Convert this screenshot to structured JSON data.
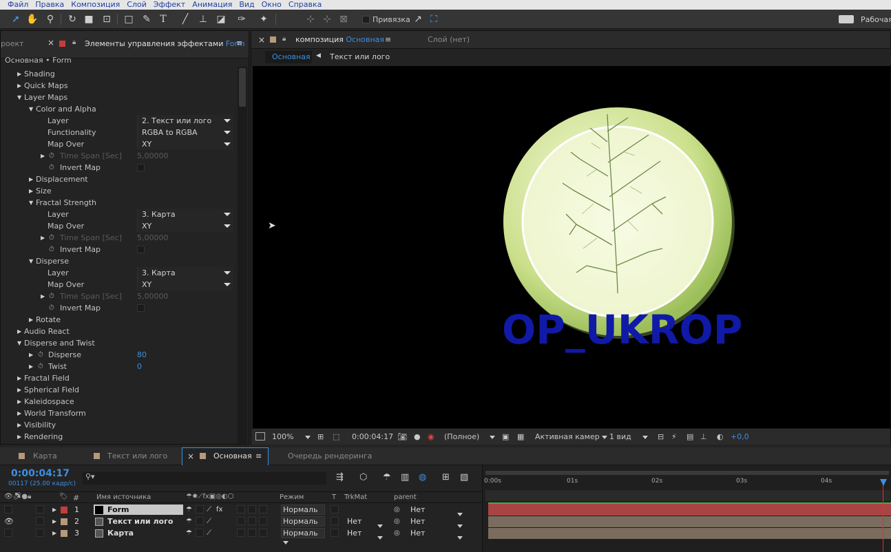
{
  "menu": [
    "Файл",
    "Правка",
    "Композиция",
    "Слой",
    "Эффект",
    "Анимация",
    "Вид",
    "Окно",
    "Справка"
  ],
  "toolbar": {
    "snap_label": "Привязка",
    "workspace_label": "Рабочая"
  },
  "left_panel": {
    "project_tab": "роект",
    "effects_tab_label": "Элементы управления эффектами",
    "effects_tab_layer": "Form",
    "breadcrumb": "Основная • Form",
    "rows": {
      "shading": "Shading",
      "quick_maps": "Quick Maps",
      "layer_maps": "Layer Maps",
      "color_alpha": "Color and Alpha",
      "ca_layer_label": "Layer",
      "ca_layer_value": "2. Текст или лого",
      "ca_func_label": "Functionality",
      "ca_func_value": "RGBA to RGBA",
      "ca_mapover_label": "Map Over",
      "ca_mapover_value": "XY",
      "ca_timespan_label": "Time Span [Sec]",
      "ca_timespan_value": "5,00000",
      "ca_invert_label": "Invert Map",
      "displacement": "Displacement",
      "size": "Size",
      "fractal_strength": "Fractal Strength",
      "fs_layer_label": "Layer",
      "fs_layer_value": "3. Карта",
      "fs_mapover_label": "Map Over",
      "fs_mapover_value": "XY",
      "fs_timespan_label": "Time Span [Sec]",
      "fs_timespan_value": "5,00000",
      "fs_invert_label": "Invert Map",
      "disperse": "Disperse",
      "d_layer_label": "Layer",
      "d_layer_value": "3. Карта",
      "d_mapover_label": "Map Over",
      "d_mapover_value": "XY",
      "d_timespan_label": "Time Span [Sec]",
      "d_timespan_value": "5,00000",
      "d_invert_label": "Invert Map",
      "rotate": "Rotate",
      "audio_react": "Audio React",
      "disperse_twist": "Disperse and Twist",
      "dt_disperse_label": "Disperse",
      "dt_disperse_value": "80",
      "dt_twist_label": "Twist",
      "dt_twist_value": "0",
      "fractal_field": "Fractal Field",
      "spherical_field": "Spherical Field",
      "kaleidospace": "Kaleidospace",
      "world_transform": "World Transform",
      "visibility": "Visibility",
      "rendering": "Rendering"
    }
  },
  "viewer": {
    "comp_tab_prefix": "композиция",
    "comp_tab_name": "Основная",
    "layer_tab": "Слой (нет)",
    "flow_current": "Основная",
    "flow_next": "Текст или лого",
    "logo_text": "OP_UKROP",
    "bottom": {
      "zoom": "100%",
      "timecode": "0:00:04:17",
      "resolution": "(Полное)",
      "camera": "Активная камер",
      "views": "1 вид",
      "exposure": "+0,0"
    }
  },
  "timeline": {
    "tabs": [
      "Карта",
      "Текст или лого",
      "Основная",
      "Очередь рендеринга"
    ],
    "timecode": "0:00:04:17",
    "frame_info": "00117 (25.00 кадр/с)",
    "columns": {
      "num": "#",
      "source": "Имя источника",
      "mode": "Режим",
      "t": "T",
      "trkmat": "TrkMat",
      "parent": "parent"
    },
    "ruler": [
      "0:00s",
      "01s",
      "02s",
      "03s",
      "04s"
    ],
    "layers": [
      {
        "num": "1",
        "name": "Form",
        "mode": "Нормаль",
        "trkmat": "",
        "parent": "Нет",
        "color": "#c43c3c"
      },
      {
        "num": "2",
        "name": "Текст или лого",
        "mode": "Нормаль",
        "trkmat": "Нет",
        "parent": "Нет",
        "color": "#b59a7a"
      },
      {
        "num": "3",
        "name": "Карта",
        "mode": "Нормаль",
        "trkmat": "Нет",
        "parent": "Нет",
        "color": "#b59a7a"
      }
    ]
  }
}
